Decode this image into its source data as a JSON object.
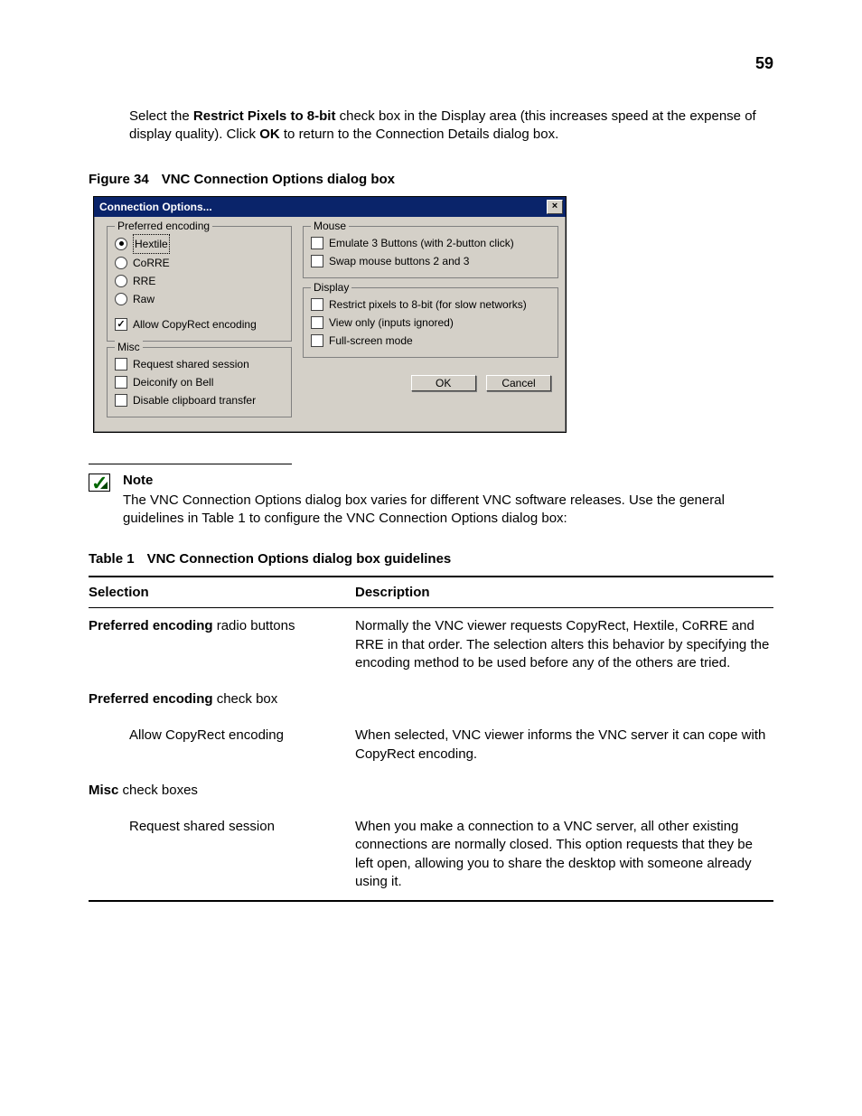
{
  "pageNumber": "59",
  "intro": {
    "pre": "Select the ",
    "bold1": "Restrict Pixels to 8-bit",
    "mid1": " check box in the Display area (this increases speed at the expense of display quality). Click ",
    "bold2": "OK",
    "post": " to return to the Connection Details dialog box."
  },
  "figCaption": {
    "label": "Figure 34",
    "title": "VNC Connection Options dialog box"
  },
  "dialog": {
    "title": "Connection Options...",
    "groups": {
      "encoding": {
        "legend": "Preferred encoding",
        "radios": [
          "Hextile",
          "CoRRE",
          "RRE",
          "Raw"
        ],
        "selectedIndex": 0,
        "copyrect": "Allow CopyRect encoding"
      },
      "misc": {
        "legend": "Misc",
        "items": [
          "Request shared session",
          "Deiconify on Bell",
          "Disable clipboard transfer"
        ]
      },
      "mouse": {
        "legend": "Mouse",
        "items": [
          "Emulate 3 Buttons (with 2-button click)",
          "Swap mouse buttons 2 and 3"
        ]
      },
      "display": {
        "legend": "Display",
        "items": [
          "Restrict pixels to 8-bit (for slow networks)",
          "View only (inputs ignored)",
          "Full-screen mode"
        ]
      }
    },
    "buttons": {
      "ok": "OK",
      "cancel": "Cancel"
    }
  },
  "note": {
    "heading": "Note",
    "body": "The VNC Connection Options dialog box varies for different VNC software releases. Use the general guidelines in Table 1 to configure the VNC Connection Options dialog box:"
  },
  "tableCaption": {
    "label": "Table 1",
    "title": "VNC Connection Options dialog box guidelines"
  },
  "table": {
    "headers": {
      "sel": "Selection",
      "desc": "Description"
    },
    "rows": [
      {
        "selBold": "Preferred encoding",
        "selRest": " radio buttons",
        "desc": "Normally the VNC viewer requests CopyRect, Hextile, CoRRE and RRE in that order. The selection alters this behavior by specifying the encoding method to be used before any of the others are tried."
      },
      {
        "selBold": "Preferred encoding",
        "selRest": " check box",
        "desc": ""
      },
      {
        "selIndent": "Allow CopyRect encoding",
        "desc": "When selected, VNC viewer informs the VNC server it can cope with CopyRect encoding."
      },
      {
        "selBold": "Misc",
        "selRest": " check boxes",
        "desc": ""
      },
      {
        "selIndent": "Request shared session",
        "desc": "When you make a connection to a VNC server, all other existing connections are normally closed. This option requests that they be left open, allowing you to share the desktop with someone already using it."
      }
    ]
  }
}
